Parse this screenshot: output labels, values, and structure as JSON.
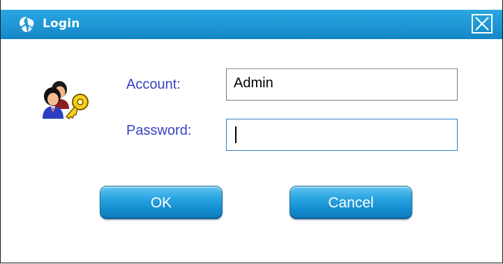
{
  "window": {
    "title": "Login",
    "close_symbol": "✕"
  },
  "icons": {
    "app": "login-app-icon",
    "user": "users-with-key-icon",
    "close": "close-icon"
  },
  "form": {
    "account_label": "Account:",
    "account_value": "Admin",
    "password_label": "Password:",
    "password_value": ""
  },
  "buttons": {
    "ok_label": "OK",
    "cancel_label": "Cancel"
  },
  "colors": {
    "titlebar": "#1e98d6",
    "label_text": "#3a3fc4",
    "button": "#1a95d6",
    "focus_border": "#2f7fc8"
  }
}
